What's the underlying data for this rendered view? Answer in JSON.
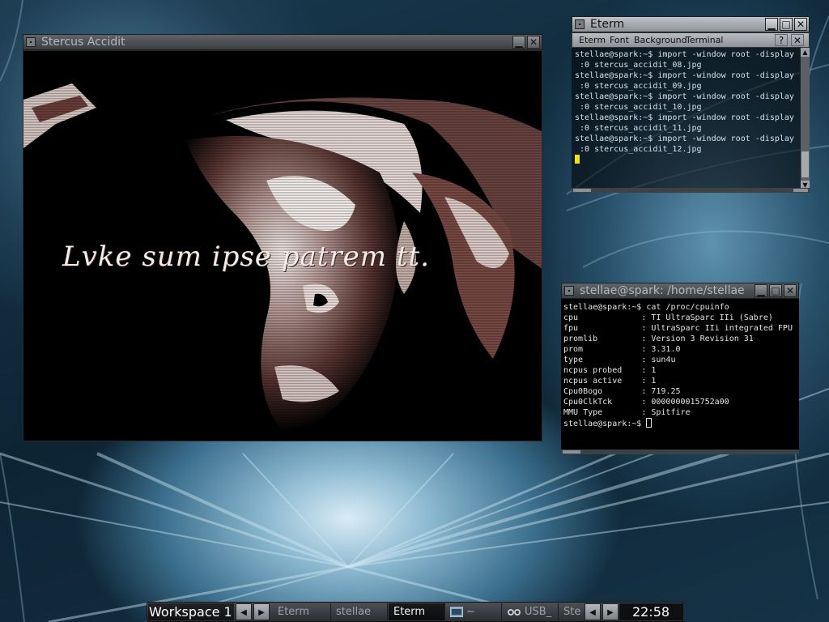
{
  "colors": {
    "titlebar_active": "#a8acb0",
    "titlebar_inactive": "#4a4e52",
    "terminal_bg": "#000000",
    "terminal_fg": "#e4e4e4",
    "cursor": "#f2e400",
    "clock_fg": "#ffffff"
  },
  "viewer": {
    "title": "Stercus Accidit",
    "caption": "Lvke sum ipse patrem tt."
  },
  "eterm": {
    "title": "Eterm",
    "menu": [
      "Eterm",
      "Font",
      "Background",
      "Terminal"
    ],
    "help_label": "?",
    "close_label": "✕",
    "lines": [
      "stellae@spark:~$ import -window root -display",
      " :0 stercus_accidit_08.jpg",
      "stellae@spark:~$ import -window root -display",
      " :0 stercus_accidit_09.jpg",
      "stellae@spark:~$ import -window root -display",
      " :0 stercus_accidit_10.jpg",
      "stellae@spark:~$ import -window root -display",
      " :0 stercus_accidit_11.jpg",
      "stellae@spark:~$ import -window root -display",
      " :0 stercus_accidit_12.jpg"
    ]
  },
  "xterm": {
    "title": "stellae@spark: /home/stellae",
    "command": "stellae@spark:~$ cat /proc/cpuinfo",
    "rows": [
      {
        "key": "cpu",
        "value": "TI UltraSparc IIi (Sabre)"
      },
      {
        "key": "fpu",
        "value": "UltraSparc IIi integrated FPU"
      },
      {
        "key": "promlib",
        "value": "Version 3 Revision 31"
      },
      {
        "key": "prom",
        "value": "3.31.0"
      },
      {
        "key": "type",
        "value": "sun4u"
      },
      {
        "key": "ncpus probed",
        "value": "1"
      },
      {
        "key": "ncpus active",
        "value": "1"
      },
      {
        "key": "Cpu0Bogo",
        "value": "719.25"
      },
      {
        "key": "Cpu0ClkTck",
        "value": "0000000015752a00"
      },
      {
        "key": "MMU Type",
        "value": "Spitfire"
      }
    ],
    "prompt": "stellae@spark:~$ "
  },
  "taskbar": {
    "workspace": "Workspace 1",
    "tasks": [
      "Eterm",
      "stellae",
      "Eterm",
      "~",
      "USB_",
      "Ste"
    ],
    "active_task_index": 2,
    "clock": "22:58"
  }
}
